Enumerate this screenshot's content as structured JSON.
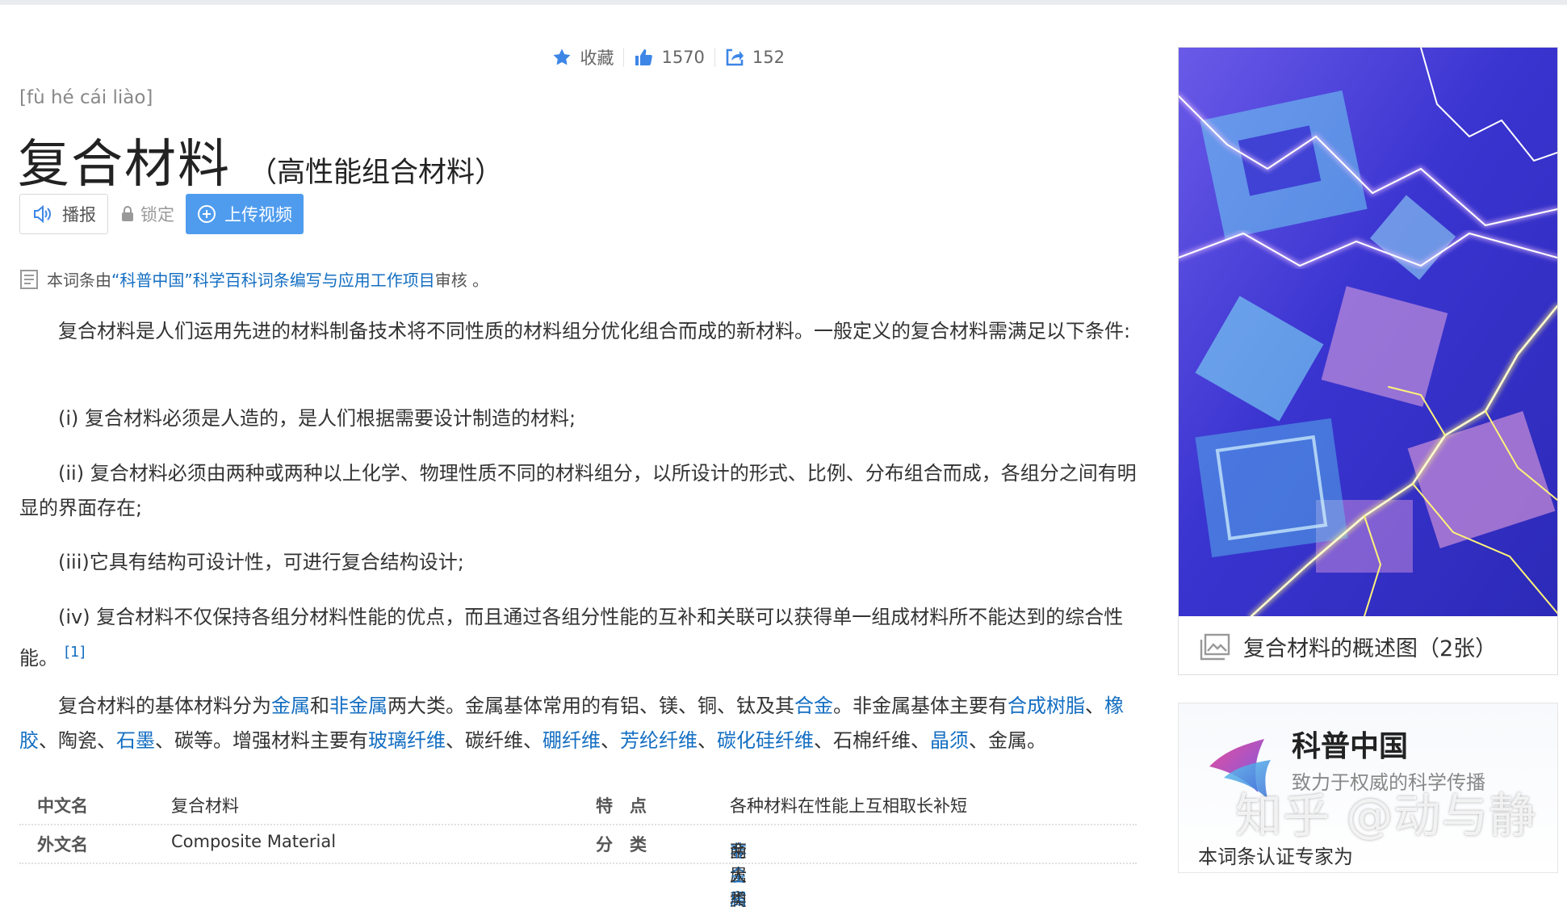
{
  "stats": {
    "favorite_label": "收藏",
    "likes": "1570",
    "shares": "152"
  },
  "entry": {
    "pinyin": "[fù hé cái liào]",
    "title": "复合材料",
    "subtitle": "（高性能组合材料）"
  },
  "actions": {
    "broadcast_label": "播报",
    "lock_label": "锁定",
    "upload_label": "上传视频"
  },
  "review": {
    "prefix": "本词条由",
    "link": "“科普中国”科学百科词条编写与应用工作项目",
    "suffix": " 审核 。"
  },
  "paragraphs": {
    "p1": "复合材料是人们运用先进的材料制备技术将不同性质的材料组分优化组合而成的新材料。一般定义的复合材料需满足以下条件:",
    "p2": "(i) 复合材料必须是人造的，是人们根据需要设计制造的材料;",
    "p3": "(ii) 复合材料必须由两种或两种以上化学、物理性质不同的材料组分，以所设计的形式、比例、分布组合而成，各组分之间有明显的界面存在;",
    "p4": "(iii)它具有结构可设计性，可进行复合结构设计;",
    "p5": "(iv) 复合材料不仅保持各组分材料性能的优点，而且通过各组分性能的互补和关联可以获得单一组成材料所不能达到的综合性能。",
    "p5_ref": "[1]",
    "p6": {
      "t1": "复合材料的基体材料分为",
      "l1": "金属",
      "t2": "和",
      "l2": "非金属",
      "t3": "两大类。金属基体常用的有铝、镁、铜、钛及其",
      "l3": "合金",
      "t4": "。非金属基体主要有",
      "l4": "合成树脂",
      "t5": "、",
      "l5": "橡胶",
      "t6": "、陶瓷、",
      "l6": "石墨",
      "t7": "、碳等。增强材料主要有",
      "l7": "玻璃纤维",
      "t8": "、碳纤维、",
      "l8": "硼纤维",
      "t9": "、",
      "l9": "芳纶纤维",
      "t10": "、",
      "l10": "碳化硅纤维",
      "t11": "、石棉纤维、",
      "l11": "晶须",
      "t12": "、金属。"
    }
  },
  "infobox": {
    "row1": {
      "k1": "中文名",
      "v1": "复合材料",
      "k2": "特　点",
      "v2": "各种材料在性能上互相取长补短"
    },
    "row2": {
      "k1": "外文名",
      "v1": "Composite Material",
      "k2": "分　类",
      "v2_t1": "金属和",
      "v2_link": "非金属",
      "v2_t2": "两大类"
    }
  },
  "album": {
    "caption": "复合材料的概述图（2张）"
  },
  "card": {
    "name": "科普中国",
    "slogan": "致力于权威的科学传播",
    "expert_label": "本词条认证专家为"
  },
  "watermark": "知乎 @动与静",
  "colors": {
    "link": "#136ec2",
    "upload_button": "#4f9cee",
    "icon_blue": "#3d86e6"
  },
  "icons": [
    "star-icon",
    "thumbs-up-icon",
    "share-icon",
    "speaker-icon",
    "lock-icon",
    "plus-circle-icon",
    "document-icon",
    "image-icon"
  ]
}
